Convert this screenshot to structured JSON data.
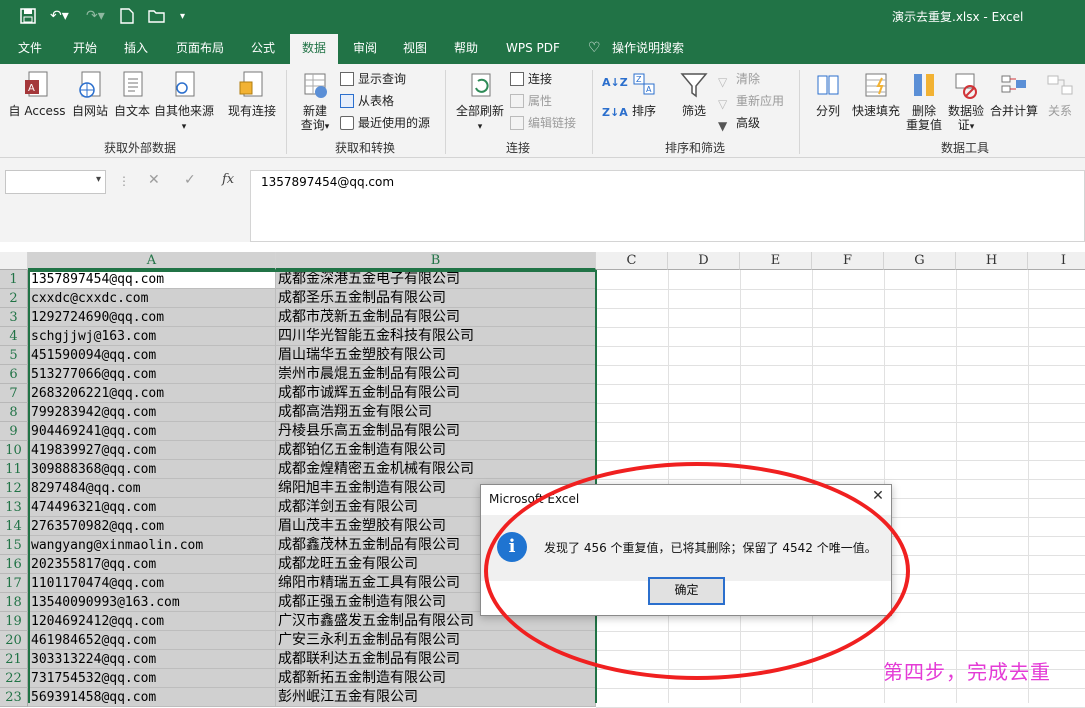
{
  "window": {
    "title": "演示去重复.xlsx  -  Excel"
  },
  "tabs": [
    "文件",
    "开始",
    "插入",
    "页面布局",
    "公式",
    "数据",
    "审阅",
    "视图",
    "帮助",
    "WPS PDF",
    "操作说明搜索"
  ],
  "active_tab": "数据",
  "ribbon": {
    "external": {
      "label": "获取外部数据",
      "items": [
        "自 Access",
        "自网站",
        "自文本",
        "自其他来源",
        "现有连接"
      ]
    },
    "transform": {
      "label": "获取和转换",
      "new_query": "新建\n查询",
      "new_query_line1": "新建",
      "new_query_line2": "查询",
      "show_query": "显示查询",
      "from_table": "从表格",
      "recent": "最近使用的源"
    },
    "connections": {
      "label": "连接",
      "refresh_all": "全部刷新",
      "connect": "连接",
      "properties": "属性",
      "edit_links": "编辑链接"
    },
    "sort_filter": {
      "label": "排序和筛选",
      "sort": "排序",
      "filter": "筛选",
      "clear": "清除",
      "reapply": "重新应用",
      "advanced": "高级"
    },
    "data_tools": {
      "label": "数据工具",
      "split": "分列",
      "flash_fill": "快速填充",
      "remove_dup_1": "删除",
      "remove_dup_2": "重复值",
      "validation_1": "数据验",
      "validation_2": "证",
      "consolidate": "合并计算",
      "relations": "关系"
    }
  },
  "formula_bar": {
    "name_box": "",
    "formula": "1357897454@qq.com"
  },
  "columns": [
    "A",
    "B",
    "C",
    "D",
    "E",
    "F",
    "G",
    "H",
    "I"
  ],
  "rows": [
    {
      "n": "1",
      "a": "1357897454@qq.com",
      "b": "成都金深港五金电子有限公司"
    },
    {
      "n": "2",
      "a": "cxxdc@cxxdc.com",
      "b": "成都圣乐五金制品有限公司"
    },
    {
      "n": "3",
      "a": "1292724690@qq.com",
      "b": "成都市茂新五金制品有限公司"
    },
    {
      "n": "4",
      "a": "schgjjwj@163.com",
      "b": "四川华光智能五金科技有限公司"
    },
    {
      "n": "5",
      "a": "451590094@qq.com",
      "b": "眉山瑞华五金塑胶有限公司"
    },
    {
      "n": "6",
      "a": "513277066@qq.com",
      "b": "崇州市晨焜五金制品有限公司"
    },
    {
      "n": "7",
      "a": "2683206221@qq.com",
      "b": "成都市诚辉五金制品有限公司"
    },
    {
      "n": "8",
      "a": "799283942@qq.com",
      "b": "成都高浩翔五金有限公司"
    },
    {
      "n": "9",
      "a": "904469241@qq.com",
      "b": "丹棱县乐高五金制品有限公司"
    },
    {
      "n": "10",
      "a": "419839927@qq.com",
      "b": "成都铂亿五金制造有限公司"
    },
    {
      "n": "11",
      "a": "309888368@qq.com",
      "b": "成都金煌精密五金机械有限公司"
    },
    {
      "n": "12",
      "a": "8297484@qq.com",
      "b": "绵阳旭丰五金制造有限公司"
    },
    {
      "n": "13",
      "a": "474496321@qq.com",
      "b": "成都洋剑五金有限公司"
    },
    {
      "n": "14",
      "a": "2763570982@qq.com",
      "b": "眉山茂丰五金塑胶有限公司"
    },
    {
      "n": "15",
      "a": "wangyang@xinmaolin.com",
      "b": "成都鑫茂林五金制品有限公司"
    },
    {
      "n": "16",
      "a": "202355817@qq.com",
      "b": "成都龙旺五金有限公司"
    },
    {
      "n": "17",
      "a": "1101170474@qq.com",
      "b": "绵阳市精瑞五金工具有限公司"
    },
    {
      "n": "18",
      "a": "13540090993@163.com",
      "b": "成都正强五金制造有限公司"
    },
    {
      "n": "19",
      "a": "1204692412@qq.com",
      "b": "广汉市鑫盛发五金制品有限公司"
    },
    {
      "n": "20",
      "a": "461984652@qq.com",
      "b": "广安三永利五金制品有限公司"
    },
    {
      "n": "21",
      "a": "303313224@qq.com",
      "b": "成都联利达五金制品有限公司"
    },
    {
      "n": "22",
      "a": "731754532@qq.com",
      "b": "成都新拓五金制造有限公司"
    },
    {
      "n": "23",
      "a": "569391458@qq.com",
      "b": "彭州岷江五金有限公司"
    }
  ],
  "dialog": {
    "title": "Microsoft Excel",
    "message": "发现了 456 个重复值，已将其删除；保留了 4542 个唯一值。",
    "ok": "确定"
  },
  "annotation": "第四步，完成去重",
  "colors": {
    "excel_green": "#217346",
    "annotation": "#e43bd6",
    "highlight_ellipse": "#f02020"
  }
}
